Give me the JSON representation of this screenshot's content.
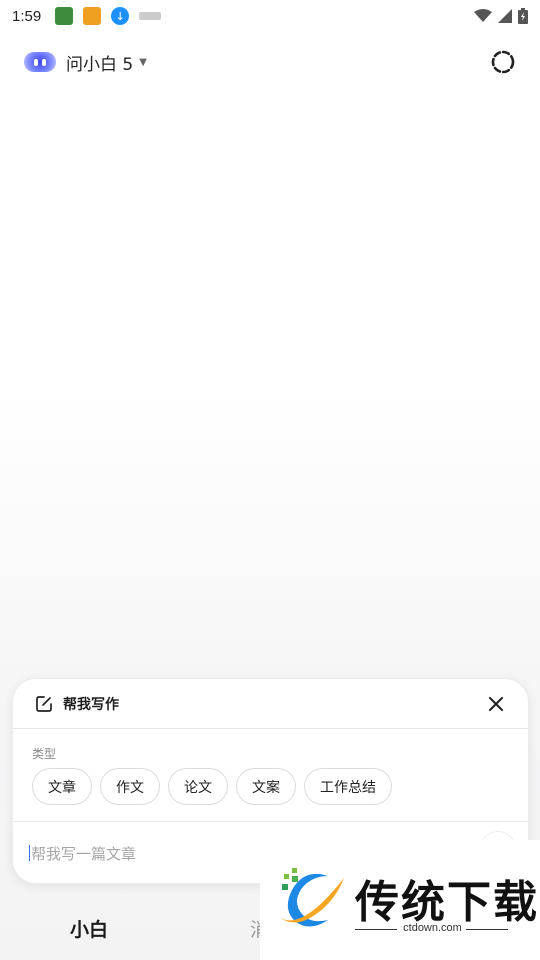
{
  "status_bar": {
    "time": "1:59",
    "apps": [
      "wechat-icon",
      "app-orange-icon",
      "download-icon",
      "app-small-icon"
    ],
    "icons": [
      "wifi-icon",
      "signal-icon",
      "battery-icon"
    ]
  },
  "header": {
    "model_name": "问小白 5",
    "dropdown_icon": "chevron-down-icon",
    "history_icon": "history-icon"
  },
  "panel": {
    "title": "帮我写作",
    "type_label": "类型",
    "chips": [
      "文章",
      "作文",
      "论文",
      "文案",
      "工作总结"
    ],
    "input_placeholder": "帮我写一篇文章"
  },
  "bottom_nav": {
    "item1": "小白",
    "item2": "消"
  },
  "watermark": {
    "text": "传统下载",
    "url": "ctdown.com"
  },
  "colors": {
    "accent": "#3d47e8",
    "chip_border": "#dcdcdc",
    "placeholder": "#a6a6a6"
  }
}
